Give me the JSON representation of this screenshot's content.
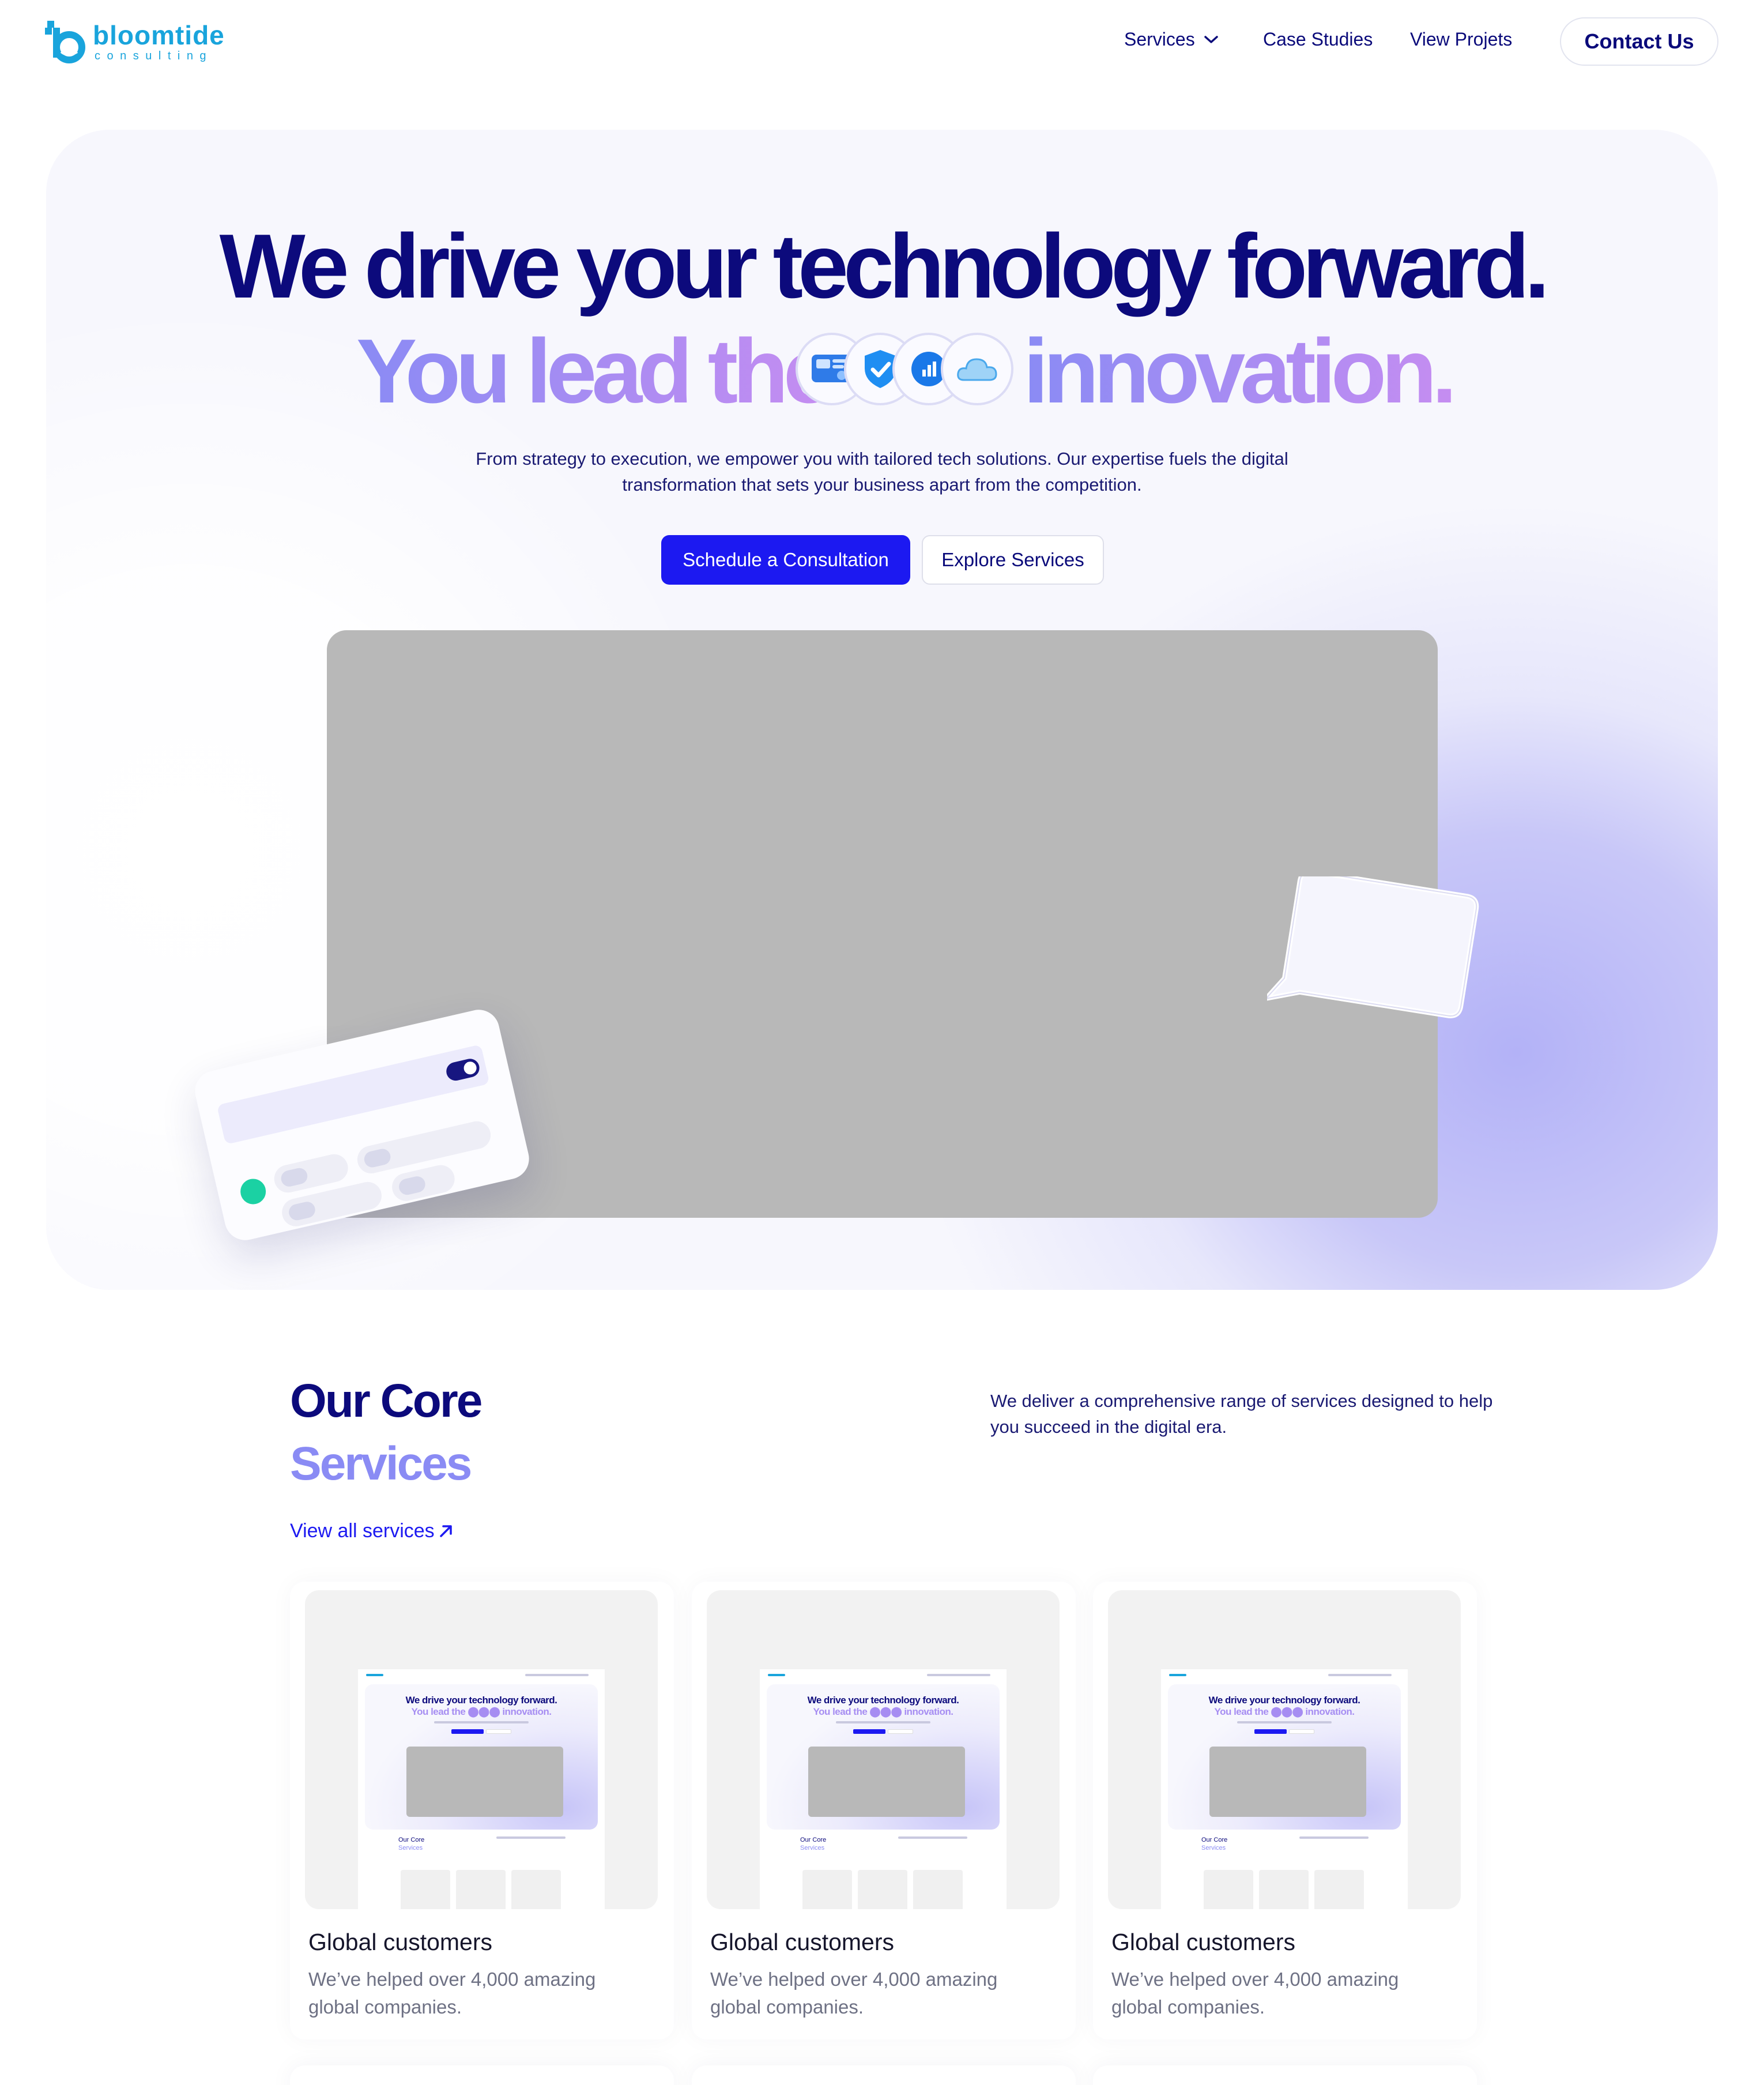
{
  "brand": {
    "name": "bloomtide",
    "tagline": "consulting",
    "color": "#19a4dc"
  },
  "nav": {
    "services": "Services",
    "case_studies": "Case Studies",
    "view_projects": "View Projets",
    "contact": "Contact Us"
  },
  "hero": {
    "headline": "We drive your technology forward.",
    "subline_left": "You lead the",
    "subline_right": "innovation.",
    "description_line1": "From strategy to execution, we empower you with tailored tech solutions. Our expertise fuels the digital",
    "description_line2": "transformation that sets your business apart from the competition.",
    "primary_cta": "Schedule a Consultation",
    "secondary_cta": "Explore Services",
    "icons": [
      "dashboard-icon",
      "shield-check-icon",
      "analytics-icon",
      "cloud-icon"
    ]
  },
  "services": {
    "title_line1": "Our Core",
    "title_line2": "Services",
    "description": "We deliver a comprehensive range of services designed to help you succeed in the digital era.",
    "view_all": "View all services",
    "cards": [
      {
        "title": "Global customers",
        "description": "We’ve helped over 4,000 amazing global companies."
      },
      {
        "title": "Global customers",
        "description": "We’ve helped over 4,000 amazing global companies."
      },
      {
        "title": "Global customers",
        "description": "We’ve helped over 4,000 amazing global companies."
      }
    ]
  },
  "mini_preview": {
    "headline": "We drive your technology forward.",
    "subline": "You lead the ⬤⬤⬤ innovation.",
    "sec_title1": "Our Core",
    "sec_title2": "Services"
  },
  "colors": {
    "navy": "#0c0a7c",
    "accent_blue": "#1c19f1",
    "lavender": "#8a8bf4",
    "violet": "#c58df1",
    "teal_dot": "#1bd1a3"
  }
}
